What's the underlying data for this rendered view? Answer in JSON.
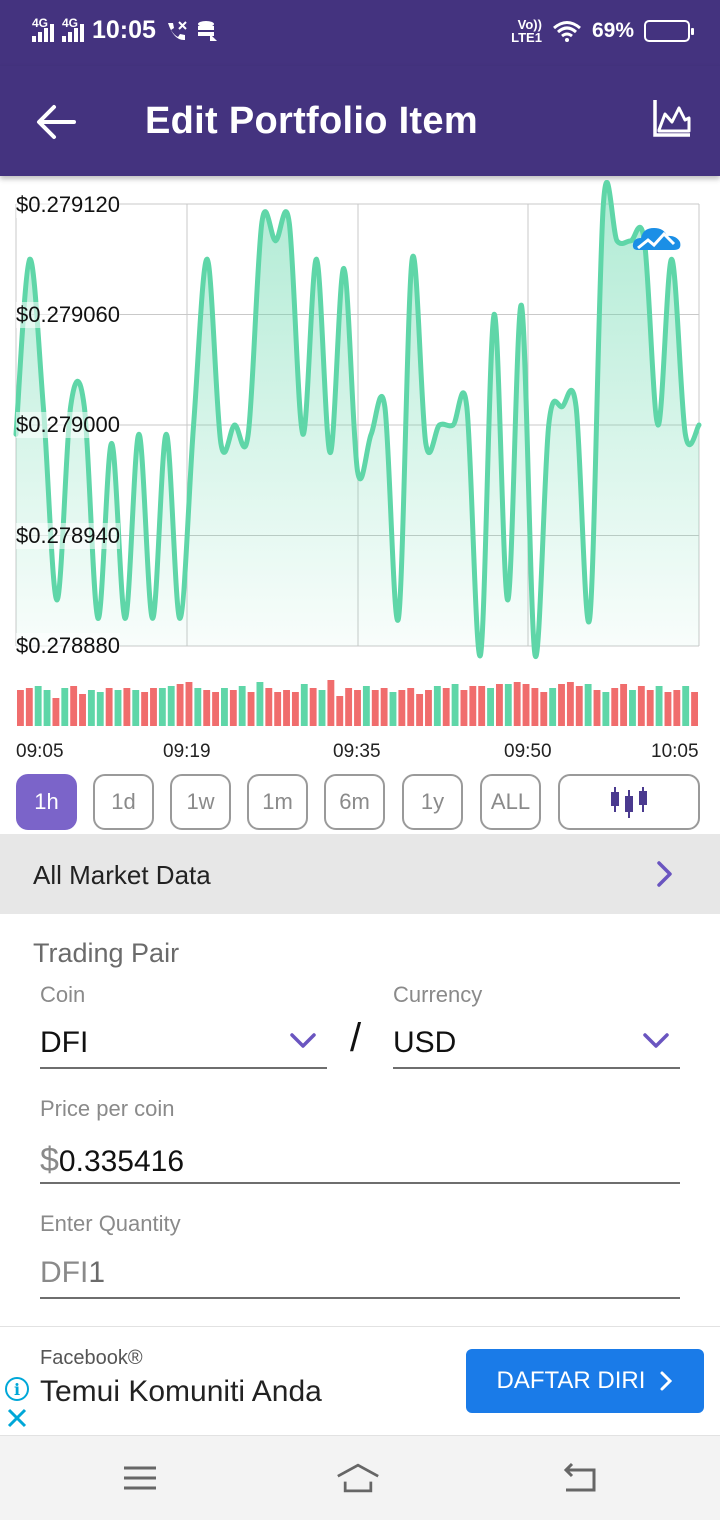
{
  "status_bar": {
    "network_left": "4G",
    "network_right": "4G",
    "time": "10:05",
    "volte": "Vo))",
    "lte": "LTE1",
    "battery": "69%",
    "battery_level": 0.69
  },
  "app_bar": {
    "title": "Edit Portfolio Item",
    "back_icon": "arrow-left-icon",
    "chart_icon": "area-chart-icon"
  },
  "chart_data": {
    "type": "line",
    "series": [
      {
        "values": [
          0.278995,
          0.27909,
          0.27901,
          0.278905,
          0.27901,
          0.27901,
          0.278895,
          0.27899,
          0.278895,
          0.278995,
          0.278895,
          0.278995,
          0.278895,
          0.279,
          0.27909,
          0.27899,
          0.279,
          0.278995,
          0.27911,
          0.2791,
          0.27911,
          0.278995,
          0.27909,
          0.278985,
          0.279085,
          0.278975,
          0.278995,
          0.27901,
          0.278895,
          0.27909,
          0.27899,
          0.279,
          0.279,
          0.27901,
          0.278875,
          0.27906,
          0.278905,
          0.279065,
          0.278875,
          0.279,
          0.27901,
          0.27901,
          0.278895,
          0.27912,
          0.2791,
          0.2791,
          0.2791,
          0.279,
          0.27909,
          0.278995,
          0.279
        ]
      }
    ],
    "volume": [
      {
        "dir": "down"
      },
      {
        "dir": "down"
      },
      {
        "dir": "up"
      },
      {
        "dir": "up"
      },
      {
        "dir": "down"
      },
      {
        "dir": "up"
      },
      {
        "dir": "down"
      },
      {
        "dir": "down"
      },
      {
        "dir": "up"
      },
      {
        "dir": "up"
      },
      {
        "dir": "down"
      },
      {
        "dir": "up"
      },
      {
        "dir": "down"
      },
      {
        "dir": "up"
      },
      {
        "dir": "down"
      },
      {
        "dir": "down"
      },
      {
        "dir": "up"
      },
      {
        "dir": "up"
      },
      {
        "dir": "down"
      },
      {
        "dir": "down"
      },
      {
        "dir": "up"
      },
      {
        "dir": "down"
      },
      {
        "dir": "down"
      },
      {
        "dir": "up"
      },
      {
        "dir": "down"
      },
      {
        "dir": "up"
      },
      {
        "dir": "down"
      },
      {
        "dir": "up"
      },
      {
        "dir": "down"
      },
      {
        "dir": "down"
      },
      {
        "dir": "down"
      },
      {
        "dir": "down"
      },
      {
        "dir": "up"
      },
      {
        "dir": "down"
      },
      {
        "dir": "up"
      },
      {
        "dir": "down"
      },
      {
        "dir": "down"
      },
      {
        "dir": "down"
      },
      {
        "dir": "down"
      },
      {
        "dir": "up"
      },
      {
        "dir": "down"
      },
      {
        "dir": "down"
      },
      {
        "dir": "up"
      },
      {
        "dir": "down"
      },
      {
        "dir": "down"
      },
      {
        "dir": "down"
      },
      {
        "dir": "down"
      },
      {
        "dir": "up"
      },
      {
        "dir": "down"
      },
      {
        "dir": "up"
      },
      {
        "dir": "down"
      },
      {
        "dir": "down"
      },
      {
        "dir": "down"
      },
      {
        "dir": "up"
      },
      {
        "dir": "down"
      },
      {
        "dir": "up"
      },
      {
        "dir": "down"
      },
      {
        "dir": "down"
      },
      {
        "dir": "down"
      },
      {
        "dir": "down"
      },
      {
        "dir": "up"
      },
      {
        "dir": "down"
      },
      {
        "dir": "down"
      },
      {
        "dir": "down"
      },
      {
        "dir": "up"
      },
      {
        "dir": "down"
      },
      {
        "dir": "up"
      },
      {
        "dir": "down"
      },
      {
        "dir": "down"
      },
      {
        "dir": "up"
      },
      {
        "dir": "down"
      },
      {
        "dir": "down"
      },
      {
        "dir": "up"
      },
      {
        "dir": "down"
      },
      {
        "dir": "down"
      },
      {
        "dir": "up"
      },
      {
        "dir": "down"
      }
    ],
    "y_ticks": [
      "$0.279120",
      "$0.279060",
      "$0.279000",
      "$0.278940",
      "$0.278880"
    ],
    "ylim": [
      0.27888,
      0.27912
    ],
    "x_ticks": [
      "09:05",
      "09:19",
      "09:35",
      "09:50",
      "10:05"
    ],
    "grid": true,
    "line_color": "#5fd6a8",
    "up_color": "#5fd6a8",
    "down_color": "#f06d6d",
    "watermark_icon": "cloud-logo-icon"
  },
  "ranges": {
    "items": [
      "1h",
      "1d",
      "1w",
      "1m",
      "6m",
      "1y",
      "ALL"
    ],
    "active": "1h",
    "candle_icon": "candlestick-icon"
  },
  "market": {
    "label": "All Market Data",
    "chevron": "chevron-right-icon"
  },
  "form": {
    "section_title": "Trading Pair",
    "coin_label": "Coin",
    "coin_value": "DFI",
    "separator": "/",
    "currency_label": "Currency",
    "currency_value": "USD",
    "price_label": "Price per coin",
    "price_prefix": "$",
    "price_value": "0.335416",
    "quantity_label": "Enter Quantity",
    "quantity_prefix": "DFI",
    "quantity_value": "1"
  },
  "ad": {
    "brand": "Facebook®",
    "text": "Temui Komuniti Anda",
    "cta": "DAFTAR DIRI"
  },
  "nav": {
    "menu_icon": "menu-icon",
    "home_icon": "home-icon",
    "back_icon": "return-icon"
  },
  "colors": {
    "primary": "#44337f",
    "accent": "#7b64c9",
    "ad_button": "#1a7be8"
  }
}
